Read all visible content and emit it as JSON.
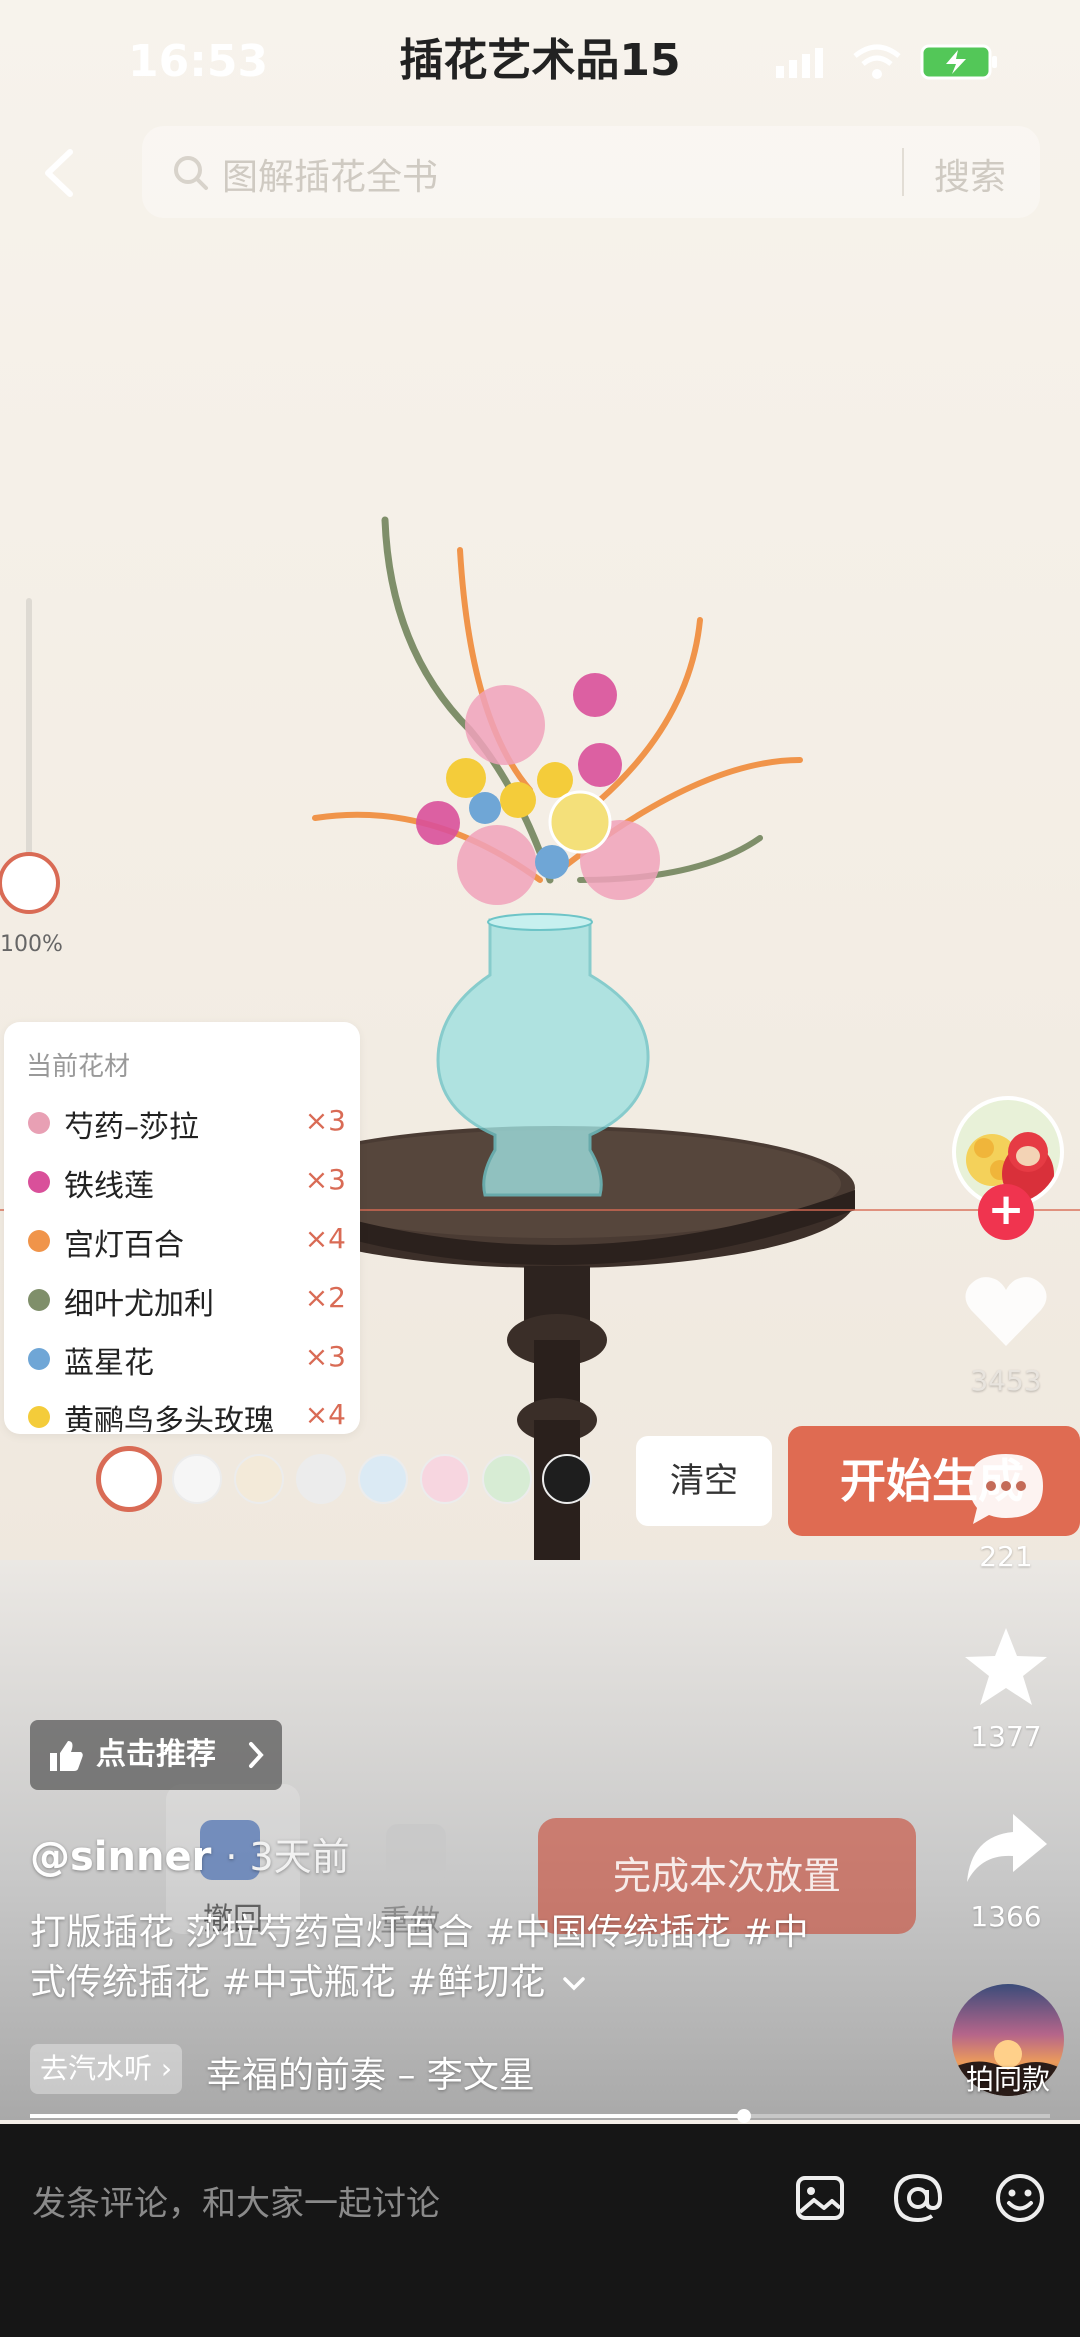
{
  "status_bar": {
    "time": "16:53",
    "title": "插花艺术品15"
  },
  "search": {
    "placeholder": "图解插花全书",
    "button": "搜索"
  },
  "zoom": {
    "label": "100%",
    "level_percent": 100
  },
  "materials": {
    "title": "当前花材",
    "items": [
      {
        "name": "芍药–莎拉",
        "count": "×3",
        "color": "#e8a0b4"
      },
      {
        "name": "铁线莲",
        "count": "×3",
        "color": "#d9509a"
      },
      {
        "name": "宫灯百合",
        "count": "×4",
        "color": "#f0944a"
      },
      {
        "name": "细叶尤加利",
        "count": "×2",
        "color": "#7f8f6a"
      },
      {
        "name": "蓝星花",
        "count": "×3",
        "color": "#6fa6d6"
      },
      {
        "name": "黄鹂鸟多头玫瑰",
        "count": "×4",
        "color": "#f4cc3a"
      }
    ]
  },
  "palette": {
    "colors": [
      "#ffffff",
      "#f6f6f6",
      "#f3ead9",
      "#ececec",
      "#dbeaf4",
      "#f7d6e0",
      "#d7ecd4",
      "#1e1e1e"
    ]
  },
  "controls": {
    "clear": "清空",
    "generate": "开始生成",
    "undo": "撤回",
    "redo": "重做",
    "complete": "完成本次放置"
  },
  "actions": {
    "likes": "3453",
    "comments": "221",
    "favorites": "1377",
    "shares": "1366",
    "same_style": "拍同款"
  },
  "video": {
    "recommend": "点击推荐",
    "author": "@sinner",
    "time": "· 3天前",
    "caption": "打版插花 莎拉芍药宫灯百合 #中国传统插花 #中式传统插花 #中式瓶花 #鲜切花",
    "music_chip": "去汽水听",
    "music_title": "幸福的前奏 – 李文星",
    "progress": 0.7
  },
  "comment": {
    "placeholder": "发条评论，和大家一起讨论"
  },
  "colors": {
    "accent": "#df6b52",
    "follow": "#f0344f",
    "bar_bg": "#161616"
  }
}
